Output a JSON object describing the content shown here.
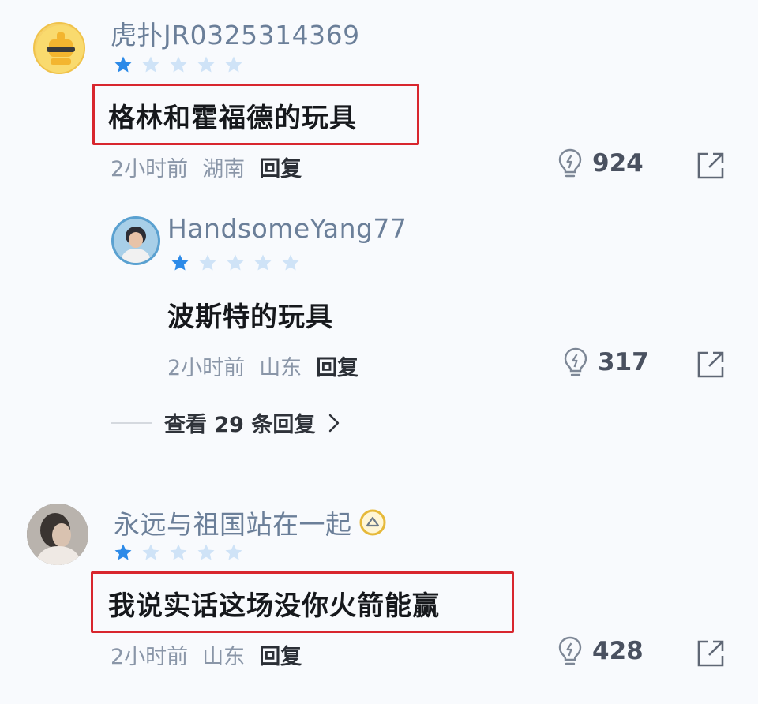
{
  "comments": [
    {
      "username": "虎扑JR0325314369",
      "rating": 1,
      "rating_max": 5,
      "text": "格林和霍福德的玩具",
      "time": "2小时前",
      "location": "湖南",
      "reply_label": "回复",
      "likes": "924",
      "highlighted": true,
      "avatar": "robot-sunglasses-avatar"
    },
    {
      "username": "HandsomeYang77",
      "rating": 1,
      "rating_max": 5,
      "text": "波斯特的玩具",
      "time": "2小时前",
      "location": "山东",
      "reply_label": "回复",
      "likes": "317",
      "highlighted": false,
      "avatar": "photo-avatar"
    },
    {
      "username": "永远与祖国站在一起",
      "rating": 1,
      "rating_max": 5,
      "text": "我说实话这场没你火箭能赢",
      "time": "2小时前",
      "location": "山东",
      "reply_label": "回复",
      "likes": "428",
      "highlighted": true,
      "avatar": "photo-avatar"
    }
  ],
  "view_more": {
    "label": "查看 29 条回复",
    "chevron": "chevron-right-icon"
  },
  "colors": {
    "star_filled": "#2c8ae8",
    "star_empty": "#cfe3f7",
    "highlight_box": "#d8262e",
    "username": "#6b7f99",
    "meta": "#8a96a8",
    "background": "#f8fafd"
  }
}
